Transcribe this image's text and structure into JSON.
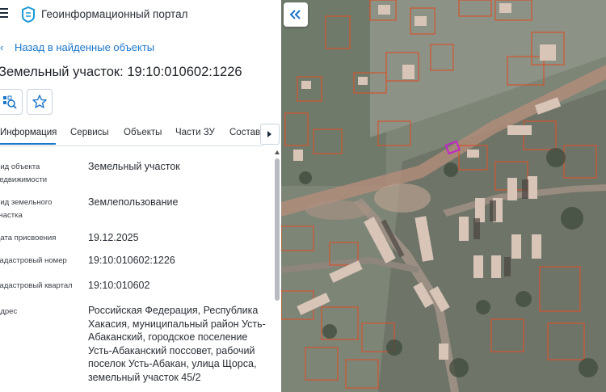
{
  "header": {
    "menu_icon": "hamburger-menu-icon",
    "logo_icon": "portal-logo-icon",
    "title": "Геоинформационный портал"
  },
  "nav": {
    "back_label": "Назад в найденные объекты"
  },
  "object": {
    "title": "Земельный участок: 19:10:010602:1226"
  },
  "actions": {
    "zoom_icon": "zoom-to-object-icon",
    "favorite_icon": "star-icon"
  },
  "tabs": [
    {
      "label": "Информация",
      "active": true
    },
    {
      "label": "Сервисы"
    },
    {
      "label": "Объекты"
    },
    {
      "label": "Части ЗУ"
    },
    {
      "label": "Состав"
    }
  ],
  "fields": [
    {
      "label": "Вид объекта недвижимости",
      "value": "Земельный участок"
    },
    {
      "label": "Вид земельного участка",
      "value": "Землепользование"
    },
    {
      "label": "Дата присвоения",
      "value": "19.12.2025"
    },
    {
      "label": "Кадастровый номер",
      "value": "19:10:010602:1226"
    },
    {
      "label": "Кадастровый квартал",
      "value": "19:10:010602"
    },
    {
      "label": "Адрес",
      "value": "Российская Федерация, Республика Хакасия, муниципальный район Усть-Абаканский, городское поселение Усть-Абаканский поссовет, рабочий поселок Усть-Абакан, улица Щорса, земельный участок 45/2"
    }
  ],
  "map": {
    "collapse_icon": "double-chevron-left-icon",
    "colors": {
      "parcel_outline": "#d2552f",
      "selected_parcel": "#c026c8",
      "ground": "#7d8577",
      "road": "#b08c7a"
    }
  }
}
